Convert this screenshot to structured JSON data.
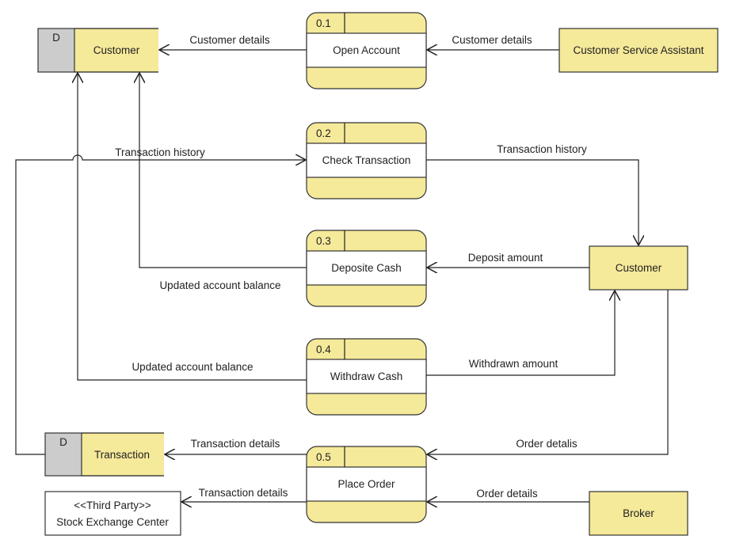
{
  "colors": {
    "process_fill": "#f5e99a",
    "store_id_fill": "#cccccc",
    "line": "#222222"
  },
  "stores": [
    {
      "id": "D",
      "name": "Customer"
    },
    {
      "id": "D",
      "name": "Transaction"
    }
  ],
  "processes": [
    {
      "number": "0.1",
      "name": "Open Account"
    },
    {
      "number": "0.2",
      "name": "Check Transaction"
    },
    {
      "number": "0.3",
      "name": "Deposite Cash"
    },
    {
      "number": "0.4",
      "name": "Withdraw Cash"
    },
    {
      "number": "0.5",
      "name": "Place Order"
    }
  ],
  "entities": [
    {
      "name": "Customer Service Assistant"
    },
    {
      "name": "Customer"
    },
    {
      "name": "Broker"
    },
    {
      "stereotype": "<<Third Party>>",
      "name": "Stock Exchange Center"
    }
  ],
  "flows": [
    "Customer details",
    "Customer details",
    "Transaction history",
    "Transaction history",
    "Updated account balance",
    "Deposit amount",
    "Updated account balance",
    "Withdrawn amount",
    "Order detalis",
    "Transaction details",
    "Order details",
    "Transaction details"
  ]
}
